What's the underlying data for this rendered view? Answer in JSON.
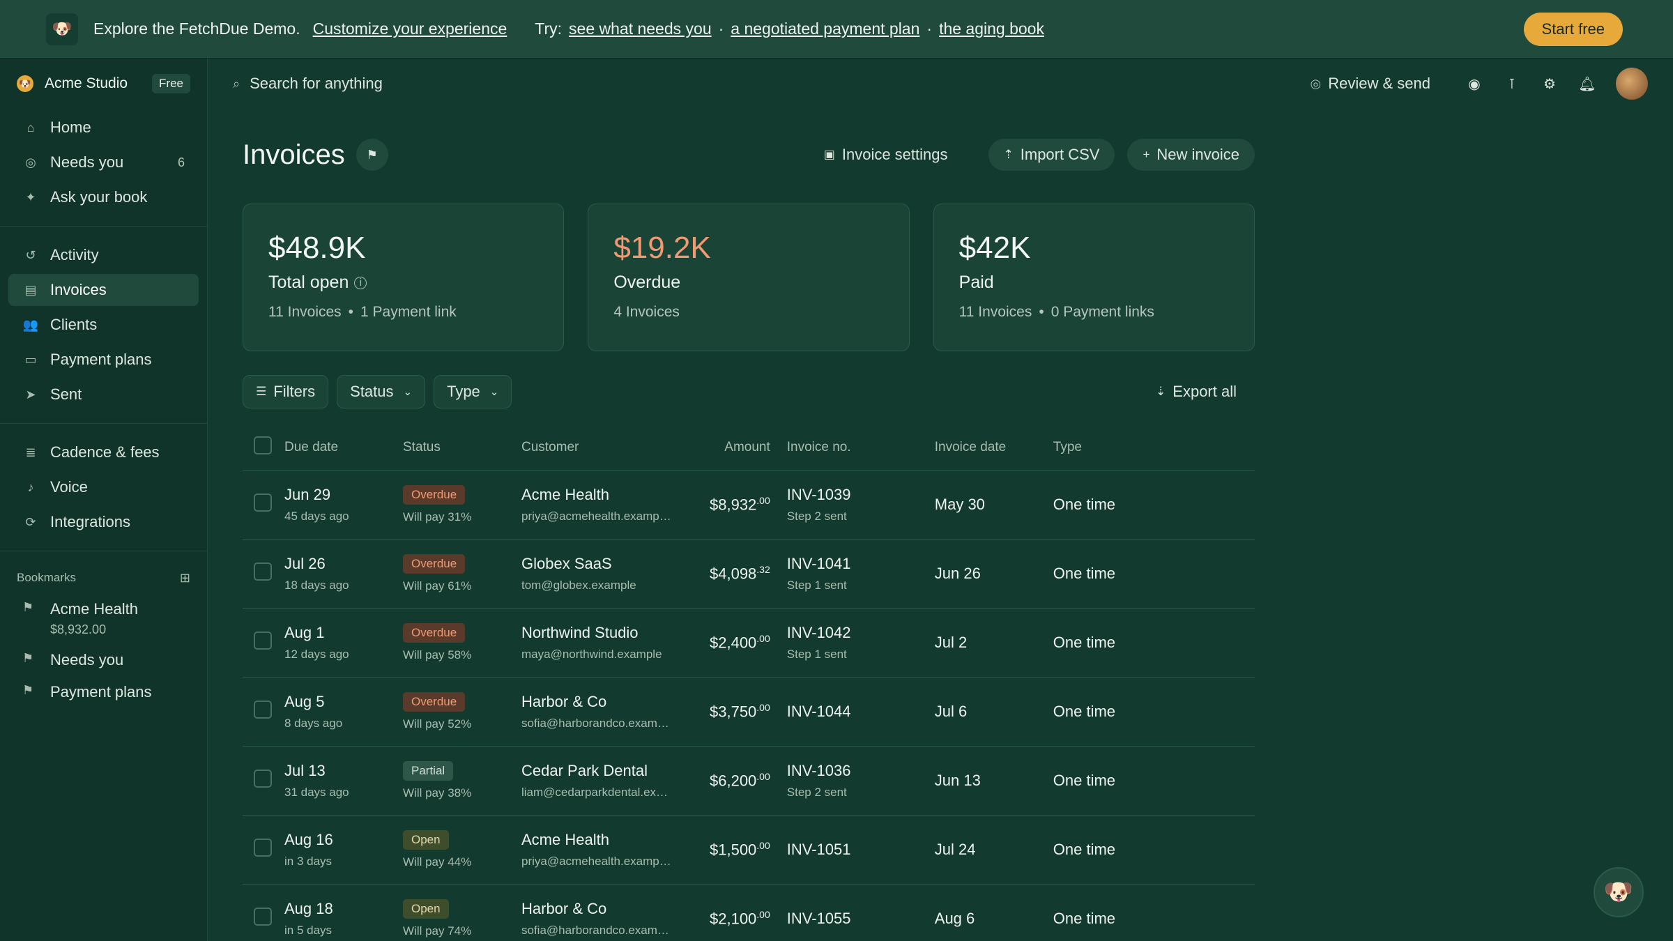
{
  "banner": {
    "text": "Explore the FetchDue Demo.",
    "customize_link": "Customize your experience",
    "try_label": "Try:",
    "links": [
      "see what needs you",
      "a negotiated payment plan",
      "the aging book"
    ],
    "start_button": "Start free"
  },
  "sidebar": {
    "workspace": "Acme Studio",
    "plan_badge": "Free",
    "primary": [
      {
        "label": "Home",
        "icon": "home-icon"
      },
      {
        "label": "Needs you",
        "count": "6",
        "icon": "check-circle-icon"
      },
      {
        "label": "Ask your book",
        "icon": "sparkle-icon"
      }
    ],
    "secondary": [
      {
        "label": "Activity",
        "icon": "history-icon"
      },
      {
        "label": "Invoices",
        "icon": "document-icon",
        "active": true
      },
      {
        "label": "Clients",
        "icon": "users-icon"
      },
      {
        "label": "Payment plans",
        "icon": "card-icon"
      },
      {
        "label": "Sent",
        "icon": "send-icon"
      }
    ],
    "tertiary": [
      {
        "label": "Cadence & fees",
        "icon": "stack-icon"
      },
      {
        "label": "Voice",
        "icon": "voice-icon"
      },
      {
        "label": "Integrations",
        "icon": "refresh-icon"
      }
    ],
    "bookmarks_title": "Bookmarks",
    "bookmarks": [
      {
        "label": "Acme Health",
        "sub": "$8,932.00"
      },
      {
        "label": "Needs you",
        "sub": ""
      },
      {
        "label": "Payment plans",
        "sub": ""
      }
    ]
  },
  "topbar": {
    "search_placeholder": "Search for anything",
    "review_label": "Review & send"
  },
  "page": {
    "title": "Invoices",
    "actions": {
      "settings": "Invoice settings",
      "import": "Import CSV",
      "new": "New invoice"
    }
  },
  "summary": [
    {
      "value": "$48.9K",
      "label": "Total open",
      "info": "i",
      "sub_a": "11 Invoices",
      "sub_b": "1 Payment link",
      "accent": "#f3f7f4"
    },
    {
      "value": "$19.2K",
      "label": "Overdue",
      "info": "",
      "sub_a": "4 Invoices",
      "sub_b": "",
      "accent": "#f09a73"
    },
    {
      "value": "$42K",
      "label": "Paid",
      "info": "",
      "sub_a": "11 Invoices",
      "sub_b": "0 Payment links",
      "accent": "#f3f7f4"
    }
  ],
  "filters": {
    "filters_label": "Filters",
    "status_label": "Status",
    "type_label": "Type",
    "export_label": "Export all"
  },
  "table": {
    "headers": [
      "Due date",
      "Status",
      "Customer",
      "Amount",
      "Invoice no.",
      "Invoice date",
      "Type"
    ],
    "rows": [
      {
        "due": "Jun 29",
        "due_sub": "45 days ago",
        "status": "Overdue",
        "status_sub": "Will pay 31%",
        "customer": "Acme Health",
        "email": "priya@acmehealth.examp…",
        "amount": "$8,932",
        "cents": ".00",
        "invoice": "INV-1039",
        "step": "Step 2 sent",
        "date": "May 30",
        "type": "One time"
      },
      {
        "due": "Jul 26",
        "due_sub": "18 days ago",
        "status": "Overdue",
        "status_sub": "Will pay 61%",
        "customer": "Globex SaaS",
        "email": "tom@globex.example",
        "amount": "$4,098",
        "cents": ".32",
        "invoice": "INV-1041",
        "step": "Step 1 sent",
        "date": "Jun 26",
        "type": "One time"
      },
      {
        "due": "Aug 1",
        "due_sub": "12 days ago",
        "status": "Overdue",
        "status_sub": "Will pay 58%",
        "customer": "Northwind Studio",
        "email": "maya@northwind.example",
        "amount": "$2,400",
        "cents": ".00",
        "invoice": "INV-1042",
        "step": "Step 1 sent",
        "date": "Jul 2",
        "type": "One time"
      },
      {
        "due": "Aug 5",
        "due_sub": "8 days ago",
        "status": "Overdue",
        "status_sub": "Will pay 52%",
        "customer": "Harbor & Co",
        "email": "sofia@harborandco.exam…",
        "amount": "$3,750",
        "cents": ".00",
        "invoice": "INV-1044",
        "step": "",
        "date": "Jul 6",
        "type": "One time"
      },
      {
        "due": "Jul 13",
        "due_sub": "31 days ago",
        "status": "Partial",
        "status_sub": "Will pay 38%",
        "customer": "Cedar Park Dental",
        "email": "liam@cedarparkdental.ex…",
        "amount": "$6,200",
        "cents": ".00",
        "invoice": "INV-1036",
        "step": "Step 2 sent",
        "date": "Jun 13",
        "type": "One time"
      },
      {
        "due": "Aug 16",
        "due_sub": "in 3 days",
        "status": "Open",
        "status_sub": "Will pay 44%",
        "customer": "Acme Health",
        "email": "priya@acmehealth.examp…",
        "amount": "$1,500",
        "cents": ".00",
        "invoice": "INV-1051",
        "step": "",
        "date": "Jul 24",
        "type": "One time"
      },
      {
        "due": "Aug 18",
        "due_sub": "in 5 days",
        "status": "Open",
        "status_sub": "Will pay 74%",
        "customer": "Harbor & Co",
        "email": "sofia@harborandco.exam…",
        "amount": "$2,100",
        "cents": ".00",
        "invoice": "INV-1055",
        "step": "",
        "date": "Aug 6",
        "type": "One time"
      }
    ]
  }
}
